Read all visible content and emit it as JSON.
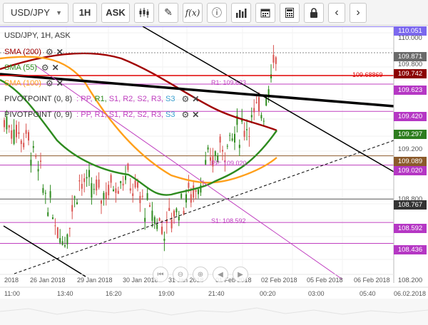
{
  "toolbar": {
    "symbol": "USD/JPY",
    "timeframe": "1H",
    "price_type": "ASK",
    "icons": [
      "candle-type-icon",
      "draw-pencil-icon",
      "function-icon",
      "info-icon",
      "volume-bars-icon",
      "calendar-icon",
      "calculator-icon",
      "lock-icon",
      "chevron-left-icon",
      "chevron-right-icon"
    ],
    "fx_label": "f(x)",
    "info_label": "ⓘ"
  },
  "legend": {
    "title": "USD/JPY, 1H, ASK",
    "sma200": "SMA (200)",
    "sma55": "SMA (55)",
    "sma100": "SMA (100)",
    "pivot1_label": "PIVOTPOINT (0, 8)",
    "pivot2_label": "PIVOTPOINT (0, 9)",
    "pivot_parts": [
      ": PP,",
      "R1,",
      "S1,",
      "R2,",
      "S2,",
      "R3,",
      "S3"
    ]
  },
  "price_axis": {
    "labels": [
      {
        "text": "110.051",
        "bg": "#7b68ee"
      },
      {
        "text": "110.000",
        "bg": ""
      },
      {
        "text": "109.800",
        "bg": ""
      },
      {
        "text": "109.871",
        "bg": "#6a6a6a"
      },
      {
        "text": "109.742",
        "bg": "#8b0000"
      },
      {
        "text": "109.623",
        "bg": "#b537c4"
      },
      {
        "text": "109.420",
        "bg": "#b537c4"
      },
      {
        "text": "109.297",
        "bg": "#2d7d1e"
      },
      {
        "text": "109.200",
        "bg": ""
      },
      {
        "text": "109.089",
        "bg": "#8b5a2b"
      },
      {
        "text": "109.020",
        "bg": "#b537c4"
      },
      {
        "text": "108.800",
        "bg": ""
      },
      {
        "text": "108.767",
        "bg": "#333333"
      },
      {
        "text": "108.592",
        "bg": "#b537c4"
      },
      {
        "text": "108.436",
        "bg": "#b537c4"
      },
      {
        "text": "108.200",
        "bg": ""
      }
    ]
  },
  "inline_labels": {
    "red_line": "109.68869",
    "r1": "R1: 109.623",
    "pp": "PP: 109.020",
    "s1": "S1: 108.592"
  },
  "date_axis": [
    "2018",
    "26 Jan 2018",
    "29 Jan 2018",
    "30 Jan 2018",
    "31 Jan 2018",
    "01 Feb 2018",
    "02 Feb 2018",
    "05 Feb 2018",
    "06 Feb 2018"
  ],
  "time_axis": [
    "11:00",
    "13:40",
    "16:20",
    "19:00",
    "21:40",
    "00:20",
    "03:00",
    "05:40",
    "06.02.2018"
  ],
  "colors": {
    "sma200": "#a00000",
    "sma55": "#2e8b1f",
    "sma100": "#ff9f1a",
    "pivot": "#c040c0",
    "red_line": "#e00000",
    "trend": "#000000",
    "candle_up": "#2e8b1f",
    "candle_down": "#d9534f"
  }
}
